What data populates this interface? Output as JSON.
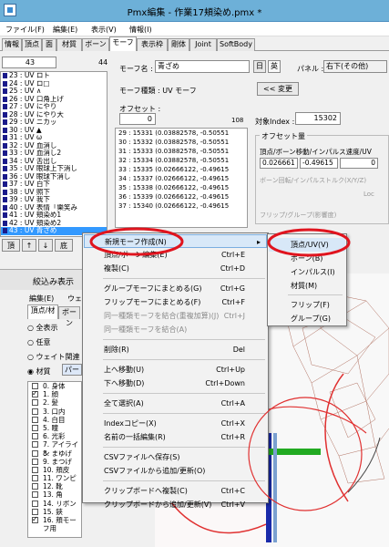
{
  "window": {
    "title": "Pmx編集 - 作業17頬染め.pmx *"
  },
  "menubar": [
    "ファイル(F)",
    "編集(E)",
    "表示(V)",
    "情報(I)"
  ],
  "tabs": [
    "情報",
    "頂点",
    "面",
    "材質",
    "ボーン",
    "モーフ",
    "表示枠",
    "剛体",
    "Joint",
    "SoftBody"
  ],
  "morph_list": {
    "index_value": "43",
    "count": "44",
    "items": [
      "23 : UV ロト",
      "24 : UV ロ□",
      "25 : UV ∧",
      "26 : UV 口角上げ",
      "27 : UV にやり",
      "28 : UV にやり大",
      "29 : UV ニカッ",
      "30 : UV ▲",
      "31 : UV ω",
      "32 : UV 血消し",
      "33 : UV 血消し2",
      "34 : UV 舌出し",
      "35 : UV 眼球上下消し",
      "36 : UV 眼球下消し",
      "37 : UV 白下",
      "38 : UV 照下",
      "39 : UV 我下",
      "40 : UV 表情「樂笑み",
      "41 : UV 頬染め1",
      "42 : UV 頬染め2",
      "43 : UV 青ざめ"
    ],
    "selected_index": 20,
    "buttons": [
      "頂",
      "↑",
      "↓",
      "底"
    ]
  },
  "morph_edit": {
    "name_label": "モーフ名 :",
    "name_value": "青ざめ",
    "lang_jp": "日",
    "lang_en": "英",
    "panel_label": "パネル :",
    "panel_value": "右下(その他)",
    "kind_label": "モーフ種類 : UV モーフ",
    "change_button": "<< 変更",
    "offset_label": "オフセット :",
    "offset_value": "0",
    "offset_count": "108",
    "target_label": "対象Index :",
    "target_value": "15302",
    "offset_rows": [
      "29 : 15331 (0.03882578, -0.50551",
      "30 : 15332 (0.03882578, -0.50551",
      "31 : 15333 (0.03882578, -0.50551",
      "32 : 15334 (0.03882578, -0.50551",
      "33 : 15335 (0.02666122, -0.49615",
      "34 : 15337 (0.02666122, -0.49615",
      "35 : 15338 (0.02666122, -0.49615",
      "36 : 15339 (0.02666122, -0.49615",
      "37 : 15340 (0.02666122, -0.49615"
    ],
    "amount_group": "オフセット量",
    "amount_header": "頂点/ボーン移動/インパルス速度/UV",
    "amount_v1": "0.026661",
    "amount_v2": "-0.49615",
    "amount_v3": "0",
    "bone_rot": "ボーン回転/インパルストルク(X/Y/Z)",
    "loc": "Loc",
    "flip": "フリップ/グループ(影響度)"
  },
  "lower_panel": {
    "title": "絞込み表示",
    "menu": [
      "編集(E)",
      "ウェ"
    ],
    "tabs": [
      "頂点/材",
      "ボーン"
    ],
    "radios": [
      "全表示",
      "任意",
      "ウェイト関連"
    ],
    "material_radio": "材質",
    "material_combo": "パー",
    "materials": [
      "0. 身体",
      "1. 顔",
      "2. 髪",
      "3. 口内",
      "4. 白目",
      "5. 瞳",
      "6. 光彩",
      "7. アイライン",
      "8. まゆげ",
      "9. まつげ",
      "10. 頬皮",
      "11. ワンピ",
      "12. 靴",
      "13. 角",
      "14. リボン",
      "15. 鋏",
      "16. 頬モーフ用"
    ],
    "checked": [
      1,
      16
    ]
  },
  "context_menu": {
    "items": [
      {
        "label": "新規モーフ作成(N)",
        "shortcut": "▸",
        "highlight": true
      },
      {
        "label": "頂点/ボーン編集(E)",
        "shortcut": "Ctrl+E"
      },
      {
        "label": "複製(C)",
        "shortcut": "Ctrl+D"
      },
      {
        "sep": true
      },
      {
        "label": "グループモーフにまとめる(G)",
        "shortcut": "Ctrl+G"
      },
      {
        "label": "フリップモーフにまとめる(F)",
        "shortcut": "Ctrl+F"
      },
      {
        "label": "同一種類モーフを結合(重複加算)(J)",
        "shortcut": "Ctrl+J",
        "disabled": true
      },
      {
        "label": "同一種類モーフを結合(A)",
        "disabled": true
      },
      {
        "sep": true
      },
      {
        "label": "削除(R)",
        "shortcut": "Del"
      },
      {
        "sep": true
      },
      {
        "label": "上へ移動(U)",
        "shortcut": "Ctrl+Up"
      },
      {
        "label": "下へ移動(D)",
        "shortcut": "Ctrl+Down"
      },
      {
        "sep": true
      },
      {
        "label": "全て選択(A)",
        "shortcut": "Ctrl+A"
      },
      {
        "sep": true
      },
      {
        "label": "Indexコピー(X)",
        "shortcut": "Ctrl+X"
      },
      {
        "label": "名前の一括編集(R)",
        "shortcut": "Ctrl+R"
      },
      {
        "sep": true
      },
      {
        "label": "CSVファイルへ保存(S)"
      },
      {
        "label": "CSVファイルから追加/更新(O)"
      },
      {
        "sep": true
      },
      {
        "label": "クリップボードへ複製(C)",
        "shortcut": "Ctrl+C"
      },
      {
        "label": "クリップボードから追加/更新(V)",
        "shortcut": "Ctrl+V"
      }
    ]
  },
  "submenu": {
    "items": [
      "頂点/UV(V)",
      "ボーン(B)",
      "インパルス(I)",
      "材質(M)",
      "フリップ(F)",
      "グループ(G)"
    ]
  },
  "colors": {
    "highlight_ring": "#e0141e",
    "accent": "#3399ff",
    "gizmo_green": "#22aa22",
    "gizmo_blue": "#1a2aaa"
  }
}
